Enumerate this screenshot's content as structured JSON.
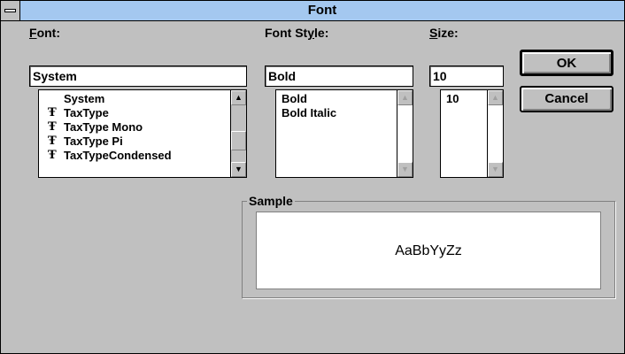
{
  "window": {
    "title": "Font"
  },
  "font": {
    "label_prefix": "",
    "label_mnemonic": "F",
    "label_rest": "ont:",
    "value": "System",
    "items": [
      "System",
      "TaxType",
      "TaxType Mono",
      "TaxType Pi",
      "TaxTypeCondensed"
    ],
    "item_icons": [
      "",
      "truetype-icon",
      "truetype-icon",
      "truetype-icon",
      "truetype-icon"
    ]
  },
  "style": {
    "label_prefix": "Font St",
    "label_mnemonic": "y",
    "label_rest": "le:",
    "value": "Bold",
    "items": [
      "Bold",
      "Bold Italic"
    ]
  },
  "size": {
    "label_prefix": "",
    "label_mnemonic": "S",
    "label_rest": "ize:",
    "value": "10",
    "items": [
      "10"
    ]
  },
  "buttons": {
    "ok": "OK",
    "cancel": "Cancel"
  },
  "sample": {
    "legend": "Sample",
    "text": "AaBbYyZz"
  },
  "icons": {
    "sysmenu": "system-menu-icon",
    "truetype": "truetype-icon"
  }
}
